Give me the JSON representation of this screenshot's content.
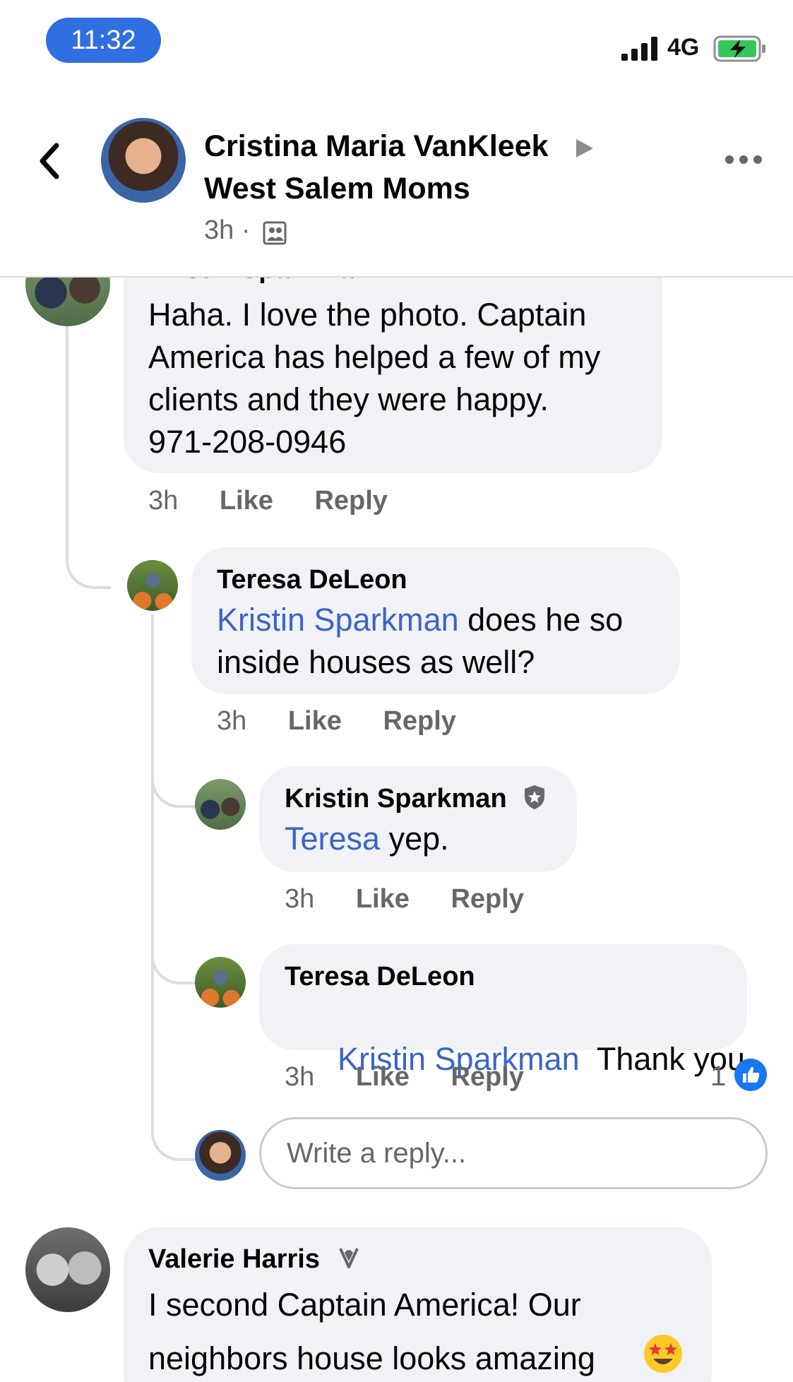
{
  "status_bar": {
    "time": "11:32",
    "network": "4G"
  },
  "header": {
    "author": "Cristina Maria VanKleek",
    "group": "West Salem Moms",
    "time": "3h",
    "separator": "·"
  },
  "comments": [
    {
      "name": "Kristin Sparkman",
      "text_lines": [
        "Haha. I love the photo.  Captain",
        "America has helped a few of my",
        "clients and they were happy.",
        "971-208-0946"
      ],
      "time": "3h",
      "like": "Like",
      "reply": "Reply"
    },
    {
      "name": "Teresa DeLeon",
      "mention": "Kristin Sparkman",
      "text_after_mention": " does he so",
      "text_line2": "inside houses as well?",
      "time": "3h",
      "like": "Like",
      "reply": "Reply"
    },
    {
      "name": "Kristin Sparkman",
      "mention": "Teresa",
      "text_after_mention": " yep.",
      "time": "3h",
      "like": "Like",
      "reply": "Reply"
    },
    {
      "name": "Teresa DeLeon",
      "mention": "Kristin Sparkman",
      "text_after_mention": "  Thank you",
      "time": "3h",
      "like": "Like",
      "reply": "Reply",
      "reaction_count": "1"
    },
    {
      "name": "Valerie Harris",
      "text_lines": [
        "I second Captain America! Our",
        "neighbors house looks amazing"
      ]
    }
  ],
  "reply_box": {
    "placeholder": "Write a reply..."
  },
  "colors": {
    "mention": "#3b63c9",
    "bubble": "#f0f2f5",
    "accent": "#1877f2"
  },
  "icons": [
    "back-chevron-icon",
    "play-triangle-icon",
    "more-dots-icon",
    "group-privacy-icon",
    "admin-badge-icon",
    "rising-contributor-icon",
    "thumbs-up-icon",
    "star-struck-emoji-icon",
    "signal-icon",
    "battery-charging-icon"
  ]
}
